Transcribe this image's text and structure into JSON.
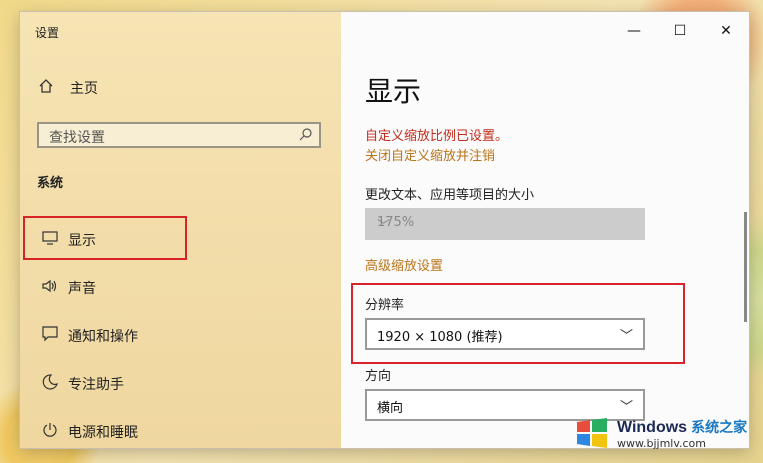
{
  "window": {
    "title": "设置",
    "minimize": "—",
    "maximize": "☐",
    "close": "✕"
  },
  "nav": {
    "home": "主页",
    "search_placeholder": "查找设置",
    "section": "系统",
    "items": [
      {
        "label": "显示",
        "icon": "monitor-icon"
      },
      {
        "label": "声音",
        "icon": "speaker-icon"
      },
      {
        "label": "通知和操作",
        "icon": "notification-icon"
      },
      {
        "label": "专注助手",
        "icon": "moon-icon"
      },
      {
        "label": "电源和睡眠",
        "icon": "power-icon"
      }
    ]
  },
  "content": {
    "title": "显示",
    "warning": "自定义缩放比例已设置。",
    "warning_link": "关闭自定义缩放并注销",
    "scale_label": "更改文本、应用等项目的大小",
    "scale_value": "175%",
    "advanced_link": "高级缩放设置",
    "resolution_label": "分辨率",
    "resolution_value": "1920 × 1080 (推荐)",
    "orientation_label": "方向",
    "orientation_value": "横向"
  },
  "watermark": {
    "brand": "Windows",
    "cn": "系统之家",
    "url": "www.bjjmlv.com"
  },
  "colors": {
    "accent": "#0078d7",
    "highlight": "#d8232a",
    "warning": "#c42b1c",
    "link": "#b8741a"
  }
}
